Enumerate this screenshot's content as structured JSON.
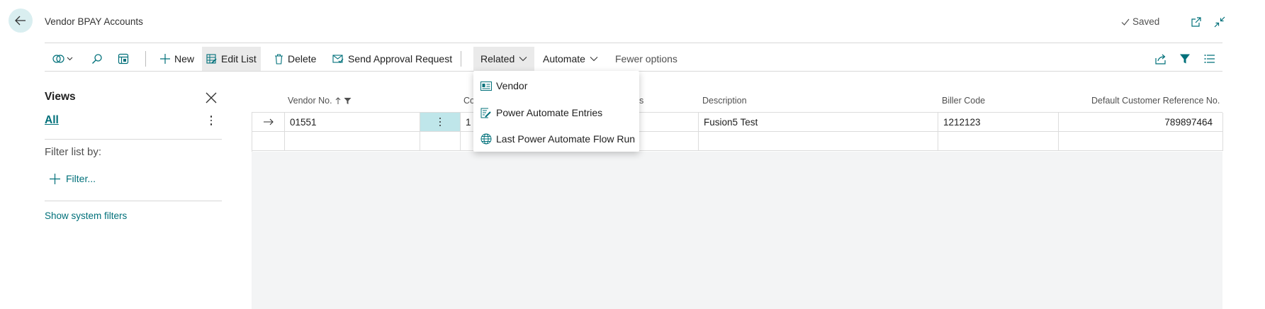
{
  "header": {
    "title": "Vendor BPAY Accounts",
    "saved_label": "Saved"
  },
  "toolbar": {
    "new_label": "New",
    "edit_list_label": "Edit List",
    "delete_label": "Delete",
    "send_approval_label": "Send Approval Request",
    "related_label": "Related",
    "automate_label": "Automate",
    "fewer_options_label": "Fewer options"
  },
  "related_menu": {
    "items": [
      {
        "label": "Vendor",
        "icon": "card-icon"
      },
      {
        "label": "Power Automate Entries",
        "icon": "entries-icon"
      },
      {
        "label": "Last Power Automate Flow Run",
        "icon": "globe-icon"
      }
    ]
  },
  "views_pane": {
    "title": "Views",
    "all_label": "All",
    "filter_by_label": "Filter list by:",
    "add_filter_label": "Filter...",
    "show_system_filters_label": "Show system filters"
  },
  "table": {
    "columns": {
      "vendor_no": "Vendor No.",
      "code_partial": "Co",
      "hidden_partial": "s",
      "description": "Description",
      "biller_code": "Biller Code",
      "default_ref": "Default Customer Reference No."
    },
    "rows": [
      {
        "vendor_no": "01551",
        "code": "1",
        "description": "Fusion5 Test",
        "biller_code": "1212123",
        "default_ref": "789897464"
      }
    ]
  },
  "colors": {
    "accent": "#00707a",
    "selected_cell": "#bfe6ea",
    "back_button_bg": "#d9eef0",
    "grid_bg": "#f3f4f5"
  }
}
